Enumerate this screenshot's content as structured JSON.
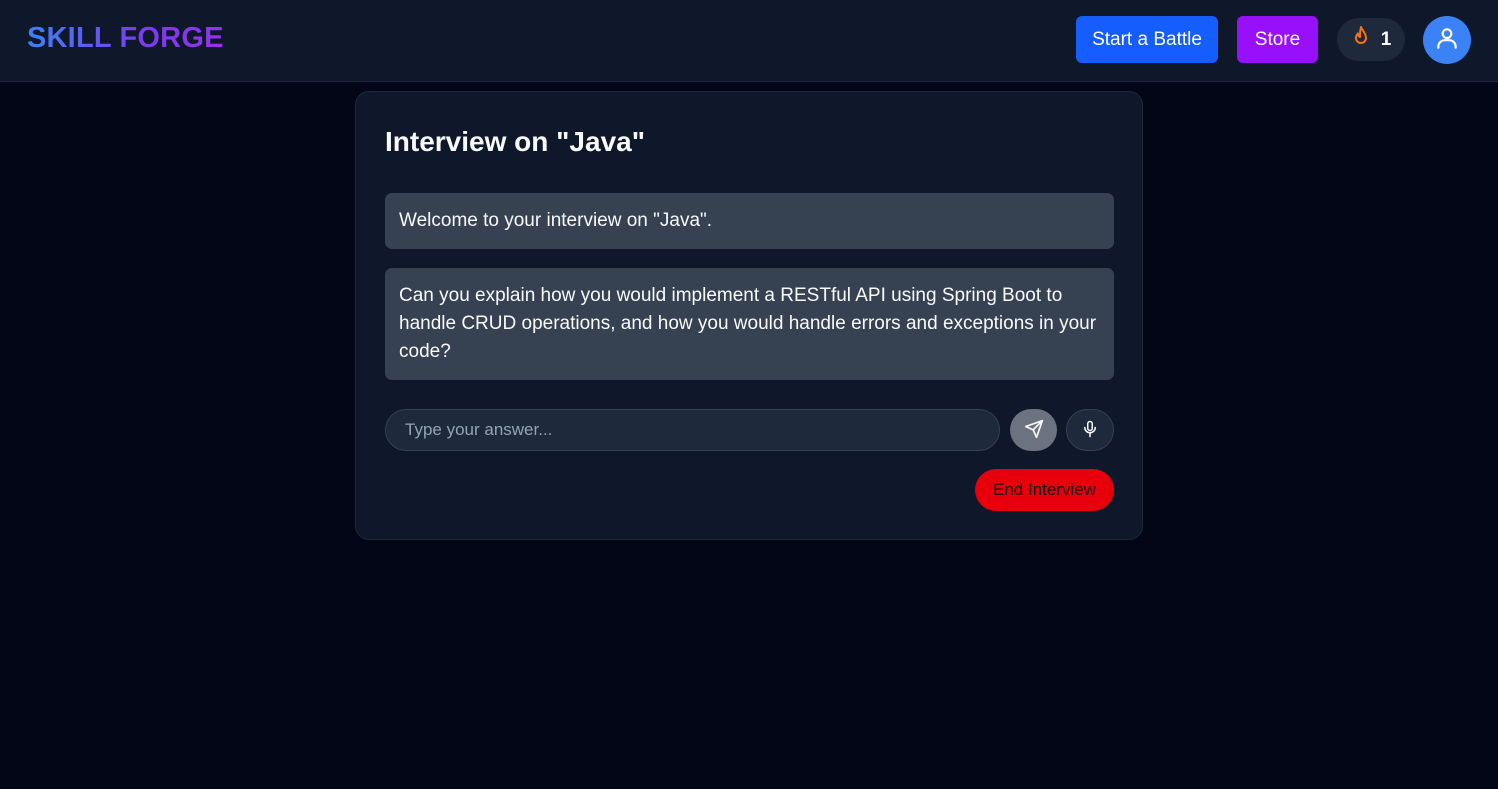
{
  "header": {
    "brand": "SKILL FORGE",
    "start_battle_label": "Start a Battle",
    "store_label": "Store",
    "streak_count": "1",
    "icons": {
      "streak": "flame-icon",
      "profile": "user-icon"
    }
  },
  "interview": {
    "title": "Interview on \"Java\"",
    "messages": [
      "Welcome to your interview on \"Java\".",
      "Can you explain how you would implement a RESTful API using Spring Boot to handle CRUD operations, and how you would handle errors and exceptions in your code?"
    ],
    "answer_placeholder": "Type your answer...",
    "answer_value": "",
    "send_icon": "send-icon",
    "mic_icon": "microphone-icon",
    "end_label": "End Interview"
  },
  "colors": {
    "background": "#020617",
    "surface": "#0f172a",
    "message_bg": "#364152",
    "battle_button": "#155dfc",
    "store_button": "#9810fa",
    "end_button": "#e7000b",
    "avatar": "#3b82f6",
    "flame": "#f97316"
  }
}
